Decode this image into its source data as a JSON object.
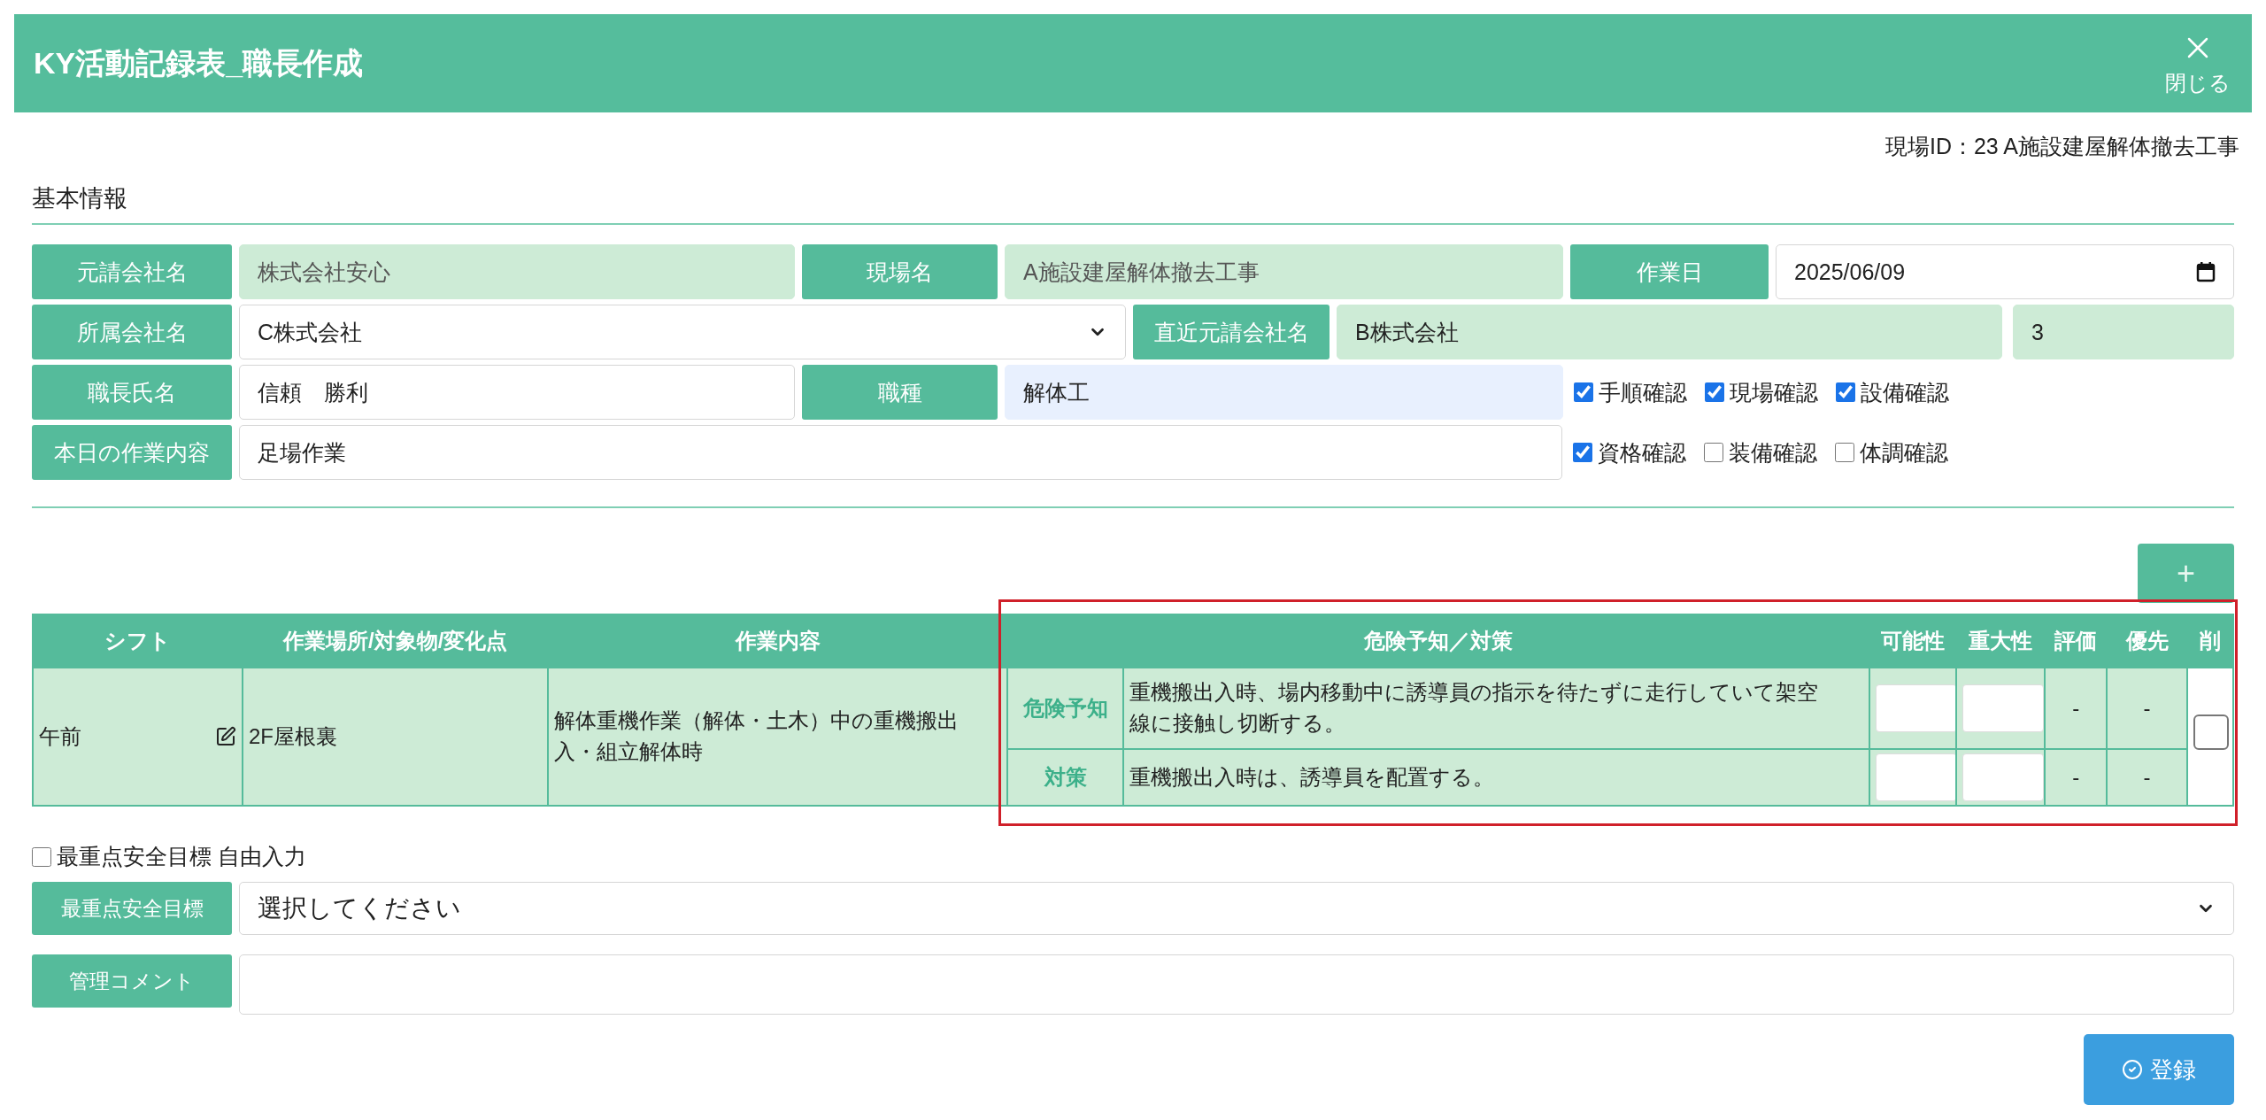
{
  "header": {
    "title": "KY活動記録表_職長作成",
    "close_label": "閉じる"
  },
  "site_id": "現場ID：23 A施設建屋解体撤去工事",
  "section_title": "基本情報",
  "basic_info": {
    "prime_contractor": {
      "label": "元請会社名",
      "value": "株式会社安心"
    },
    "site_name": {
      "label": "現場名",
      "value": "A施設建屋解体撤去工事"
    },
    "work_date": {
      "label": "作業日",
      "value": "2025/06/09"
    },
    "company": {
      "label": "所属会社名",
      "value": "C株式会社"
    },
    "direct_prime": {
      "label": "直近元請会社名",
      "value": "B株式会社",
      "extra": "3"
    },
    "foreman": {
      "label": "職長氏名",
      "value": "信頼　勝利"
    },
    "trade": {
      "label": "職種",
      "value": "解体工"
    },
    "today_work": {
      "label": "本日の作業内容",
      "value": "足場作業"
    }
  },
  "checks": [
    {
      "label": "手順確認",
      "checked": true
    },
    {
      "label": "現場確認",
      "checked": true
    },
    {
      "label": "設備確認",
      "checked": true
    },
    {
      "label": "資格確認",
      "checked": true
    },
    {
      "label": "装備確認",
      "checked": false
    },
    {
      "label": "体調確認",
      "checked": false
    }
  ],
  "add_button": "+",
  "table": {
    "columns": [
      "シフト",
      "作業場所/対象物/変化点",
      "作業内容",
      "危険予知／対策",
      "可能性",
      "重大性",
      "評価",
      "優先",
      "削"
    ],
    "rows": [
      {
        "shift": "午前",
        "place": "2F屋根裏",
        "work": "解体重機作業（解体・土木）中の重機搬出入・組立解体時",
        "delete_checked": false,
        "items": [
          {
            "label": "危険予知",
            "text": "重機搬出入時、場内移動中に誘導員の指示を待たずに走行していて架空線に接触し切断する。",
            "evaluation": "-",
            "priority": "-"
          },
          {
            "label": "対策",
            "text": "重機搬出入時は、誘導員を配置する。",
            "evaluation": "-",
            "priority": "-"
          }
        ]
      }
    ]
  },
  "free_input": {
    "label": "最重点安全目標 自由入力",
    "checked": false
  },
  "goal": {
    "label": "最重点安全目標",
    "value": "選択してください"
  },
  "comment": {
    "label": "管理コメント"
  },
  "submit": "登録"
}
